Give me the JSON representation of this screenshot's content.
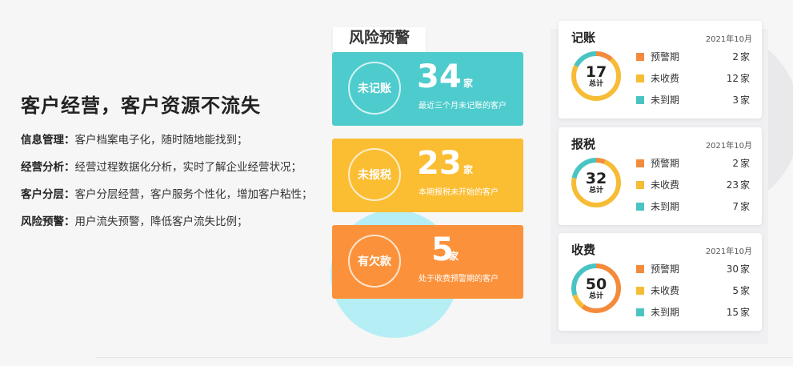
{
  "intro": {
    "title": "客户经营，客户资源不流失",
    "items": [
      {
        "label": "信息管理：",
        "text": "客户档案电子化，随时随地能找到；"
      },
      {
        "label": "经营分析：",
        "text": "经营过程数据化分析，实时了解企业经营状况；"
      },
      {
        "label": "客户分层：",
        "text": "客户分层经营，客户服务个性化，增加客户粘性；"
      },
      {
        "label": "风险预警：",
        "text": "用户流失预警，降低客户流失比例；"
      }
    ]
  },
  "risk": {
    "title": "风险预警",
    "cards": [
      {
        "ring": "未记账",
        "value": "34",
        "unit": "家",
        "desc": "最近三个月未记账的客户",
        "color": "#4ecbcd"
      },
      {
        "ring": "未报税",
        "value": "23",
        "unit": "家",
        "desc": "本期报税未开始的客户",
        "color": "#fbbd32"
      },
      {
        "ring": "有欠款",
        "value": "5",
        "unit": "家",
        "desc": "处于收费预警期的客户",
        "color": "#fb923b"
      }
    ]
  },
  "stats": [
    {
      "title": "记账",
      "date": "2021年10月",
      "total": "17",
      "total_label": "总计",
      "rows": [
        {
          "label": "预警期",
          "value": 2,
          "unit": "家",
          "color": "#f38b3c"
        },
        {
          "label": "未收费",
          "value": 12,
          "unit": "家",
          "color": "#f7bc36"
        },
        {
          "label": "未到期",
          "value": 3,
          "unit": "家",
          "color": "#4ac4c3"
        }
      ]
    },
    {
      "title": "报税",
      "date": "2021年10月",
      "total": "32",
      "total_label": "总计",
      "rows": [
        {
          "label": "预警期",
          "value": 2,
          "unit": "家",
          "color": "#f38b3c"
        },
        {
          "label": "未收费",
          "value": 23,
          "unit": "家",
          "color": "#f7bc36"
        },
        {
          "label": "未到期",
          "value": 7,
          "unit": "家",
          "color": "#4ac4c3"
        }
      ]
    },
    {
      "title": "收费",
      "date": "2021年10月",
      "total": "50",
      "total_label": "总计",
      "rows": [
        {
          "label": "预警期",
          "value": 30,
          "unit": "家",
          "color": "#f38b3c"
        },
        {
          "label": "未收费",
          "value": 5,
          "unit": "家",
          "color": "#f7bc36"
        },
        {
          "label": "未到期",
          "value": 15,
          "unit": "家",
          "color": "#4ac4c3"
        }
      ]
    }
  ]
}
